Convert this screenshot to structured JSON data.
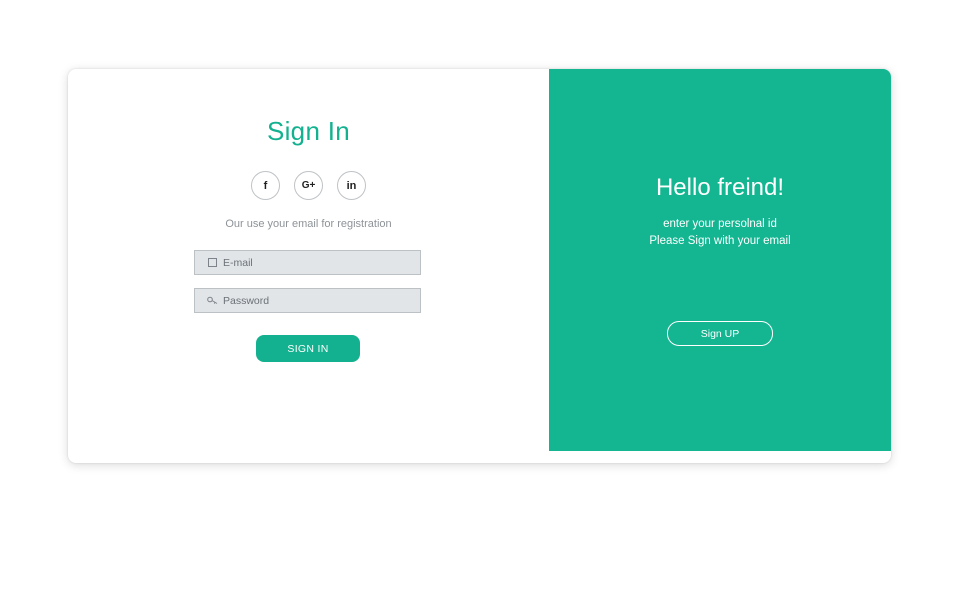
{
  "signin": {
    "title": "Sign In",
    "social": {
      "facebook": "f",
      "google": "G+",
      "linkedin": "in"
    },
    "hint": "Our use your email for registration",
    "email_placeholder": "E-mail",
    "password_placeholder": "Password",
    "button_label": "SIGN IN",
    "icons": {
      "email": "email-icon",
      "password": "key-icon"
    }
  },
  "welcome": {
    "heading": "Hello freind!",
    "line1": "enter your persolnal id",
    "line2": "Please Sign with your email",
    "button_label": "Sign UP"
  },
  "colors": {
    "accent": "#13b18f",
    "panel": "#13b691",
    "field_bg": "#e1e5e8"
  }
}
